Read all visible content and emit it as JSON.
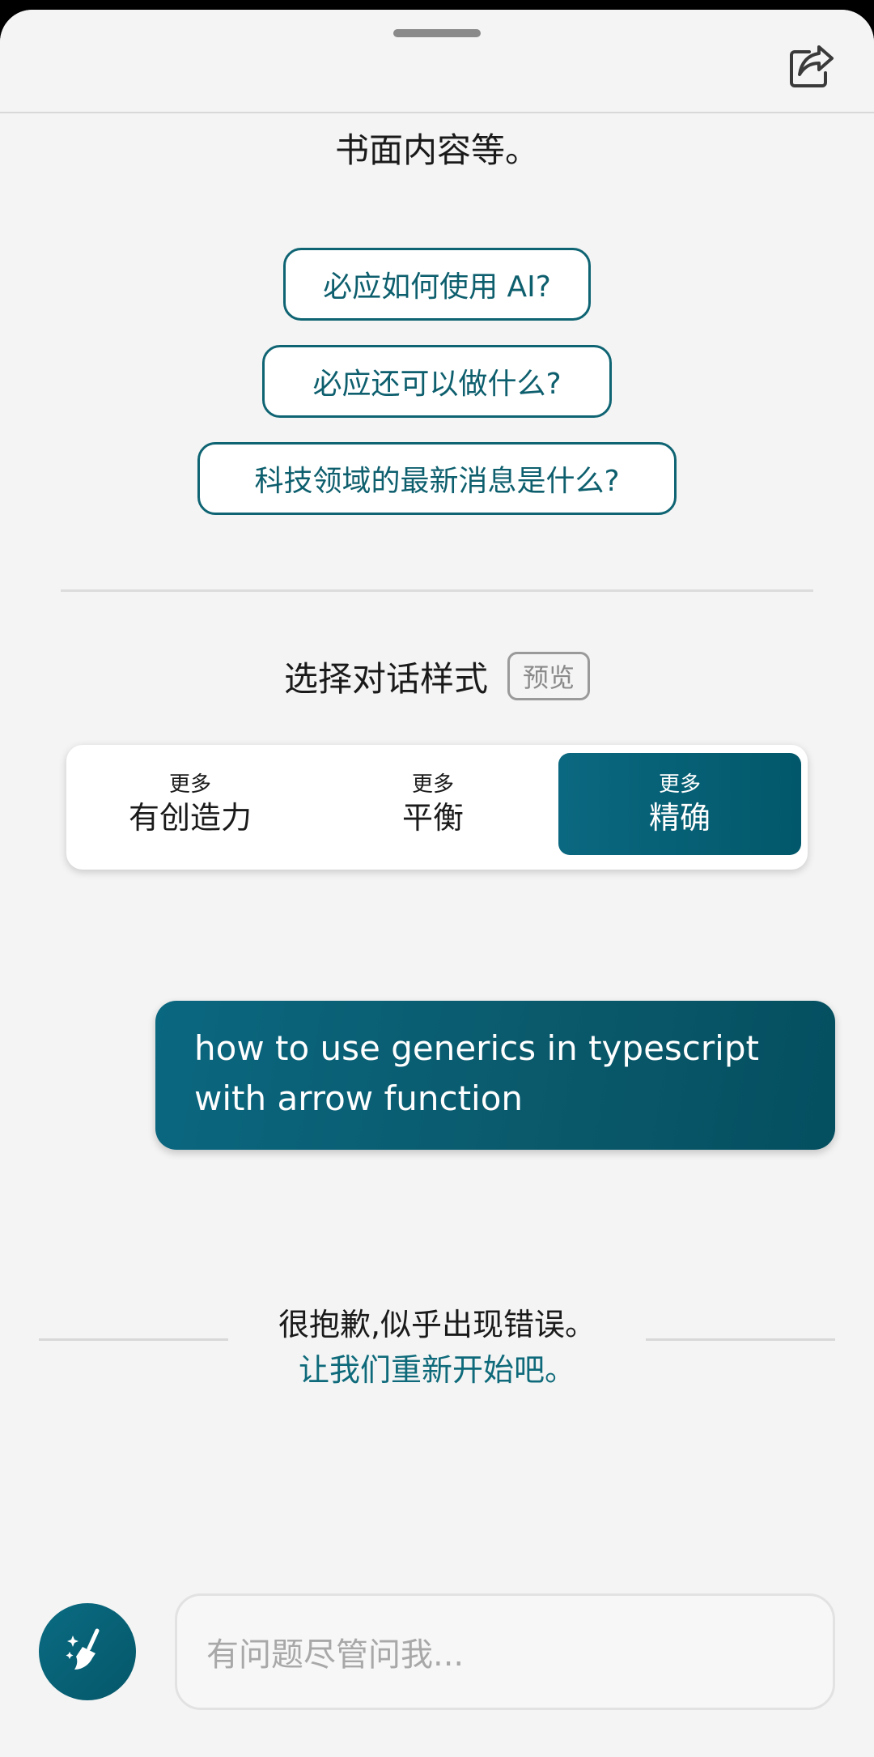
{
  "intro": {
    "tail_text": "书面内容等。"
  },
  "suggestions": [
    {
      "label": "必应如何使用 AI?"
    },
    {
      "label": "必应还可以做什么?"
    },
    {
      "label": "科技领域的最新消息是什么?"
    }
  ],
  "conversation_style": {
    "title": "选择对话样式",
    "badge": "预览",
    "options": [
      {
        "small": "更多",
        "label": "有创造力",
        "selected": false
      },
      {
        "small": "更多",
        "label": "平衡",
        "selected": false
      },
      {
        "small": "更多",
        "label": "精确",
        "selected": true
      }
    ]
  },
  "messages": [
    {
      "role": "user",
      "text": "how to use generics in typescript with arrow function"
    }
  ],
  "error": {
    "message": "很抱歉,似乎出现错误。",
    "restart_link": "让我们重新开始吧。"
  },
  "composer": {
    "placeholder": "有问题尽管问我..."
  },
  "icons": {
    "share": "share-icon",
    "new_topic": "broom-sparkle-icon"
  },
  "colors": {
    "accent": "#0a6780",
    "background": "#f4f4f4"
  }
}
